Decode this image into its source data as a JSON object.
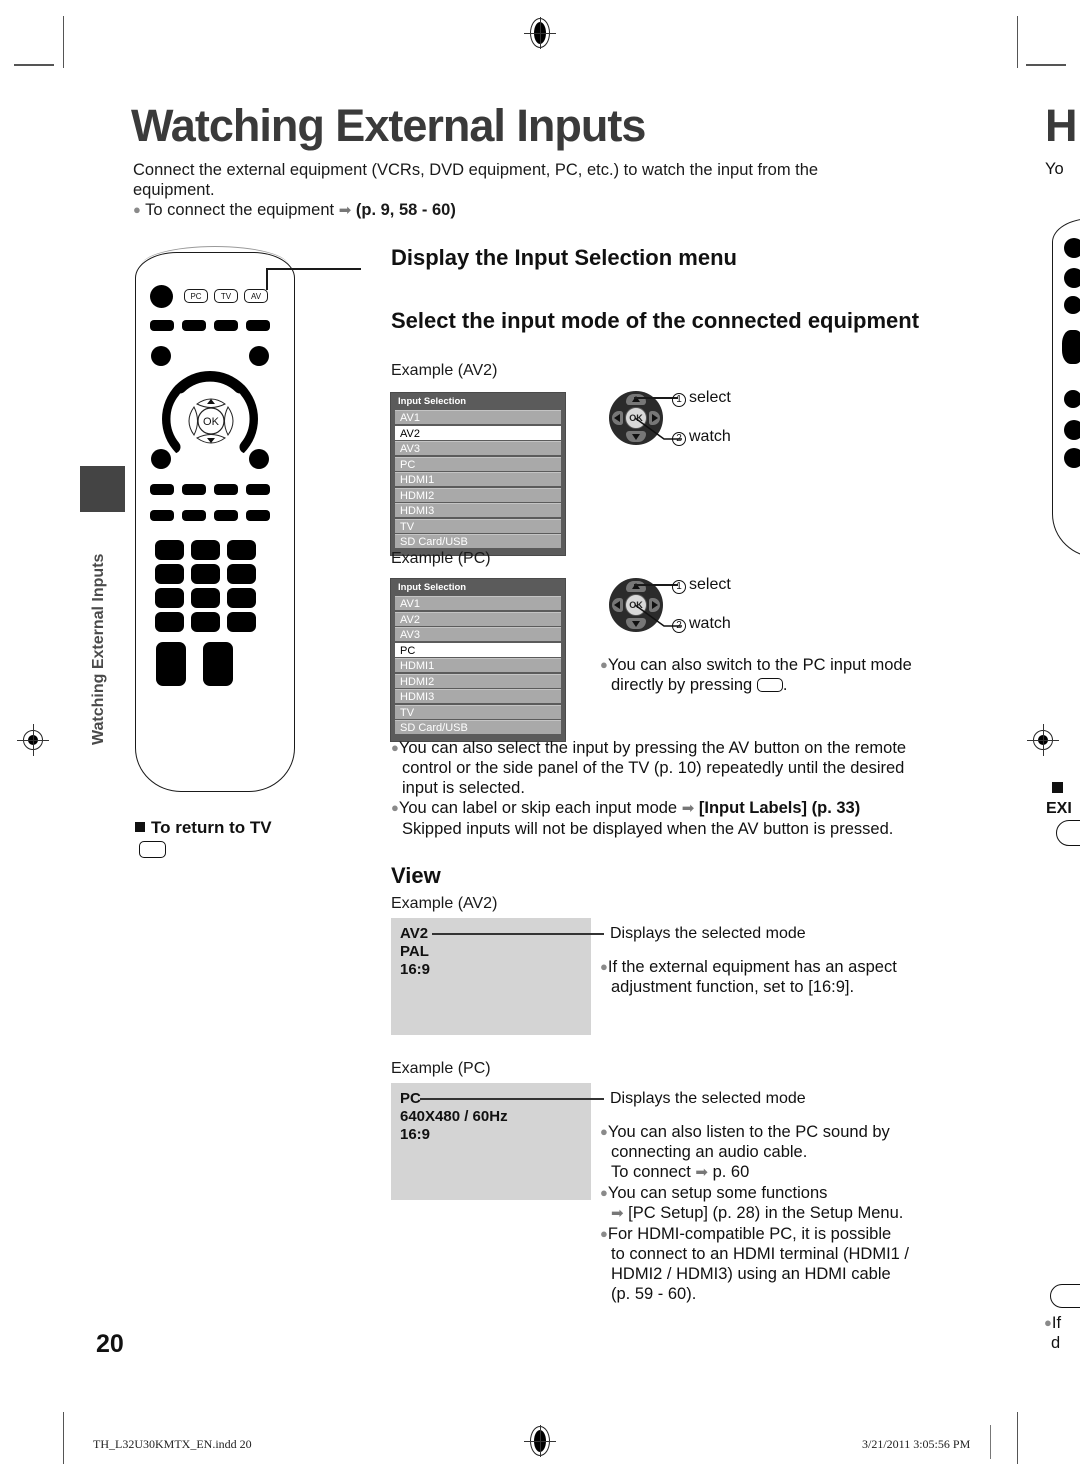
{
  "document": {
    "page_number": "20",
    "footer_file": "TH_L32U30KMTX_EN.indd   20",
    "footer_timestamp": "3/21/2011   3:05:56 PM",
    "side_tab_label": "Watching External Inputs"
  },
  "header": {
    "title": "Watching External Inputs",
    "intro": "Connect the external equipment (VCRs, DVD equipment, PC, etc.) to watch the input from the equipment.",
    "intro_bullet_text": "To connect the equipment",
    "intro_bullet_ref": "(p. 9, 58 - 60)"
  },
  "remote": {
    "labels": [
      "PC",
      "TV",
      "AV"
    ],
    "ok_label": "OK",
    "return_heading": "To return to TV"
  },
  "sections": {
    "display_menu_heading": "Display the Input Selection menu",
    "select_mode_heading": "Select the input mode of the connected equipment",
    "view_heading": "View"
  },
  "examples": {
    "av2_caption": "Example (AV2)",
    "pc_caption": "Example (PC)"
  },
  "osd": {
    "title": "Input Selection",
    "items": [
      "AV1",
      "AV2",
      "AV3",
      "PC",
      "HDMI1",
      "HDMI2",
      "HDMI3",
      "TV",
      "SD Card/USB"
    ],
    "selected_av2": "AV2",
    "selected_pc": "PC"
  },
  "steps": {
    "one": "1",
    "two": "2",
    "select": "select",
    "watch": "watch",
    "ok": "OK"
  },
  "notes": {
    "pc_direct_1": "You can also switch to the PC input mode",
    "pc_direct_2": "directly by pressing",
    "pc_direct_3": ".",
    "av_button_1": "You can also select the input by pressing the AV button on the remote",
    "av_button_2": "control or the side panel of the TV (p. 10) repeatedly until the desired",
    "av_button_3": "input is selected.",
    "input_labels_1": "You can label or skip each input mode",
    "input_labels_ref": "[Input Labels] (p. 33)",
    "input_labels_2": "Skipped inputs will not be displayed when the AV button is pressed."
  },
  "view": {
    "av2_screen": {
      "line1": "AV2",
      "line2": "PAL",
      "line3": "16:9"
    },
    "av2_callout": "Displays the selected mode",
    "av2_note_1": "If the external equipment has an aspect",
    "av2_note_2": "adjustment function, set to [16:9].",
    "pc_screen": {
      "line1": "PC",
      "line2": "640X480 / 60Hz",
      "line3": "16:9"
    },
    "pc_callout": "Displays the selected mode",
    "pc_notes": [
      "You can also listen to the PC sound by",
      "connecting an audio cable.",
      "To connect",
      "p. 60",
      "You can setup some functions",
      "[PC Setup] (p. 28) in the Setup Menu.",
      "For HDMI-compatible PC, it is possible",
      "to connect to an HDMI terminal (HDMI1 /",
      "HDMI2 / HDMI3) using an HDMI cable",
      "(p. 59 - 60)."
    ]
  },
  "next_page": {
    "title_fragment": "H",
    "intro_fragment": "Yo",
    "exit_fragment": "EXI",
    "bullet_fragment_1": "If",
    "bullet_fragment_2": "d"
  },
  "colors": {
    "osd_background": "#5b5b5b",
    "osd_row": "#a9a9a9",
    "osd_selected": "#ffffff",
    "screen_gray": "#d4d4d4",
    "title_gray": "#3a3a3a",
    "tab_gray": "#444444"
  }
}
